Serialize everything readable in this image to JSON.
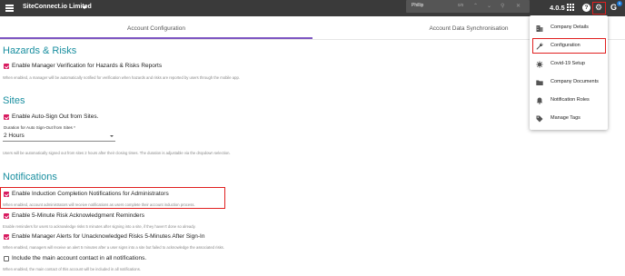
{
  "topbar": {
    "company": "SiteConnect.io Limited",
    "search_value": "Phillip",
    "search_count": "0/0",
    "version": "4.0.5",
    "notification_count": "5"
  },
  "tabs": [
    {
      "label": "Account Configuration"
    },
    {
      "label": "Account Data Synchronisation"
    }
  ],
  "sections": {
    "hazards": {
      "title": "Hazards & Risks",
      "options": [
        {
          "label": "Enable Manager Verification for Hazards & Risks Reports",
          "checked": true,
          "help": "When enabled, a manager will be automatically notified for verification when hazards and risks are reported by users through the mobile app."
        }
      ]
    },
    "sites": {
      "title": "Sites",
      "options": [
        {
          "label": "Enable Auto-Sign Out from Sites.",
          "checked": true,
          "help": "Users will be automatically signed out from sites 2 hours after their closing times. The duration is adjustable via the dropdown selection."
        }
      ],
      "duration_label": "Duration for Auto Sign-Out from Sites *",
      "duration_value": "2 Hours"
    },
    "notifications": {
      "title": "Notifications",
      "options": [
        {
          "label": "Enable Induction Completion Notifications for Administrators",
          "checked": true,
          "help": "When enabled, account administrators will receive notifications as users complete their account induction process."
        },
        {
          "label": "Enable 5-Minute Risk Acknowledgment Reminders",
          "checked": true,
          "help": "Enable reminders for users to acknowledge risks 5 minutes after signing into a site, if they haven't done so already."
        },
        {
          "label": "Enable Manager Alerts for Unacknowledged Risks 5-Minutes After Sign-In",
          "checked": true,
          "help": "When enabled, managers will receive an alert 5 minutes after a user signs into a site but failed to acknowledge the associated risks."
        },
        {
          "label": "Include the main account contact in all notifications.",
          "checked": false,
          "help": "When enabled, the main contact of this account will be included in all notifications."
        }
      ]
    }
  },
  "menu": {
    "items": [
      {
        "label": "Company Details",
        "icon": "building-icon"
      },
      {
        "label": "Configuration",
        "icon": "wrench-icon"
      },
      {
        "label": "Covid-19 Setup",
        "icon": "virus-icon"
      },
      {
        "label": "Company Documents",
        "icon": "folder-icon"
      },
      {
        "label": "Notification Roles",
        "icon": "bell-icon"
      },
      {
        "label": "Manage Tags",
        "icon": "tag-icon"
      }
    ]
  },
  "colors": {
    "topbar": "#3a3a3a",
    "accent_title": "#1a8fa0",
    "checkbox": "#d81b60",
    "tab_indicator": "#7e57c2",
    "highlight_box": "#e02020"
  }
}
